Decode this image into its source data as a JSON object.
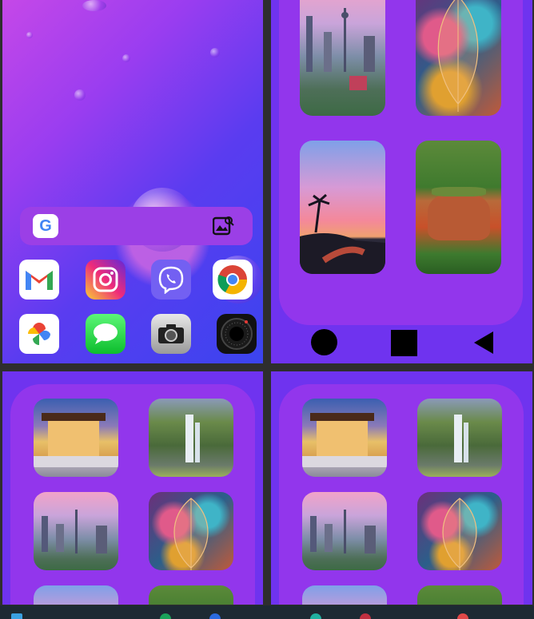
{
  "home_screen": {
    "search_bar": {
      "google_logo_text": "G"
    },
    "dock_row1": [
      {
        "name": "gmail",
        "glyph": "M"
      },
      {
        "name": "instagram",
        "glyph": "◎"
      },
      {
        "name": "viber",
        "glyph": "✆"
      },
      {
        "name": "chrome",
        "glyph": "◉"
      }
    ],
    "dock_row2": [
      {
        "name": "photos",
        "glyph": "✿"
      },
      {
        "name": "messages",
        "glyph": "💬"
      },
      {
        "name": "camera",
        "glyph": "📷"
      },
      {
        "name": "clock",
        "glyph": "◯"
      }
    ]
  },
  "widgets": {
    "photos_top_right": [
      "city-skyline",
      "leaf",
      "beach-sunset",
      "rock-fortress"
    ],
    "photos_bottom": [
      "temple",
      "waterfall",
      "city-skyline",
      "leaf",
      "beach-sunset",
      "rock-fortress"
    ]
  },
  "nav_bar": {
    "icons": [
      "home-icon",
      "recents-icon",
      "back-icon"
    ]
  },
  "colors": {
    "widget_bg": "#9236ec",
    "panel_bg": "#6f33ef"
  }
}
